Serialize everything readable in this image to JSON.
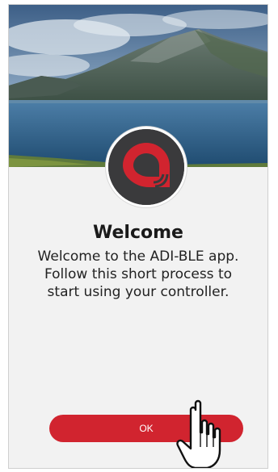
{
  "welcome": {
    "title": "Welcome",
    "line1": "Welcome to the ADI-BLE app.",
    "line2": "Follow this short process to",
    "line3": "start using your controller."
  },
  "actions": {
    "ok_label": "OK"
  },
  "icons": {
    "logo": "adi-ble-logo-icon",
    "cursor": "hand-pointer-icon"
  },
  "colors": {
    "accent": "#d1242f",
    "logo_background": "#3a3a3c",
    "page_background": "#f2f2f2"
  }
}
